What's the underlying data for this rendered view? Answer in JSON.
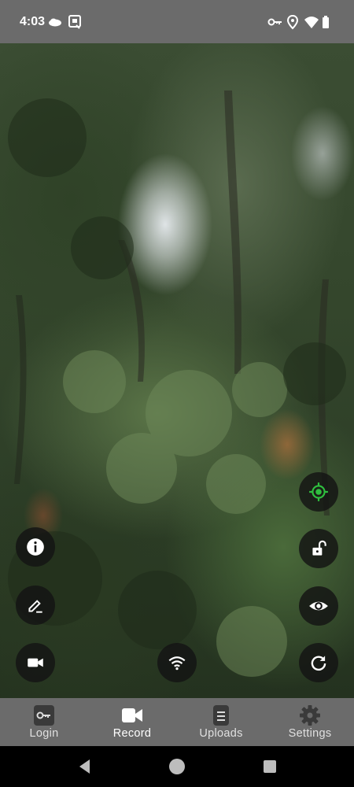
{
  "status_bar": {
    "time": "4:03",
    "left_icons": [
      "cloud-icon",
      "screenshot-icon"
    ],
    "right_icons": [
      "vpn-key-icon",
      "location-icon",
      "wifi-icon",
      "battery-icon"
    ]
  },
  "camera": {
    "left_buttons": [
      "info-icon",
      "edit-icon",
      "video-camera-icon"
    ],
    "center_buttons": [
      "wifi-icon"
    ],
    "right_buttons": [
      "gps-target-icon",
      "unlock-icon",
      "eye-icon",
      "refresh-icon"
    ],
    "colors": {
      "button_bg": "#141414",
      "gps_accent": "#2fbf3f"
    }
  },
  "bottom_nav": {
    "items": [
      {
        "label": "Login",
        "icon": "key-icon",
        "active": false
      },
      {
        "label": "Record",
        "icon": "video-camera-icon",
        "active": true
      },
      {
        "label": "Uploads",
        "icon": "document-icon",
        "active": false
      },
      {
        "label": "Settings",
        "icon": "gear-icon",
        "active": false
      }
    ]
  },
  "system_nav": [
    "back-icon",
    "home-icon",
    "recents-icon"
  ]
}
